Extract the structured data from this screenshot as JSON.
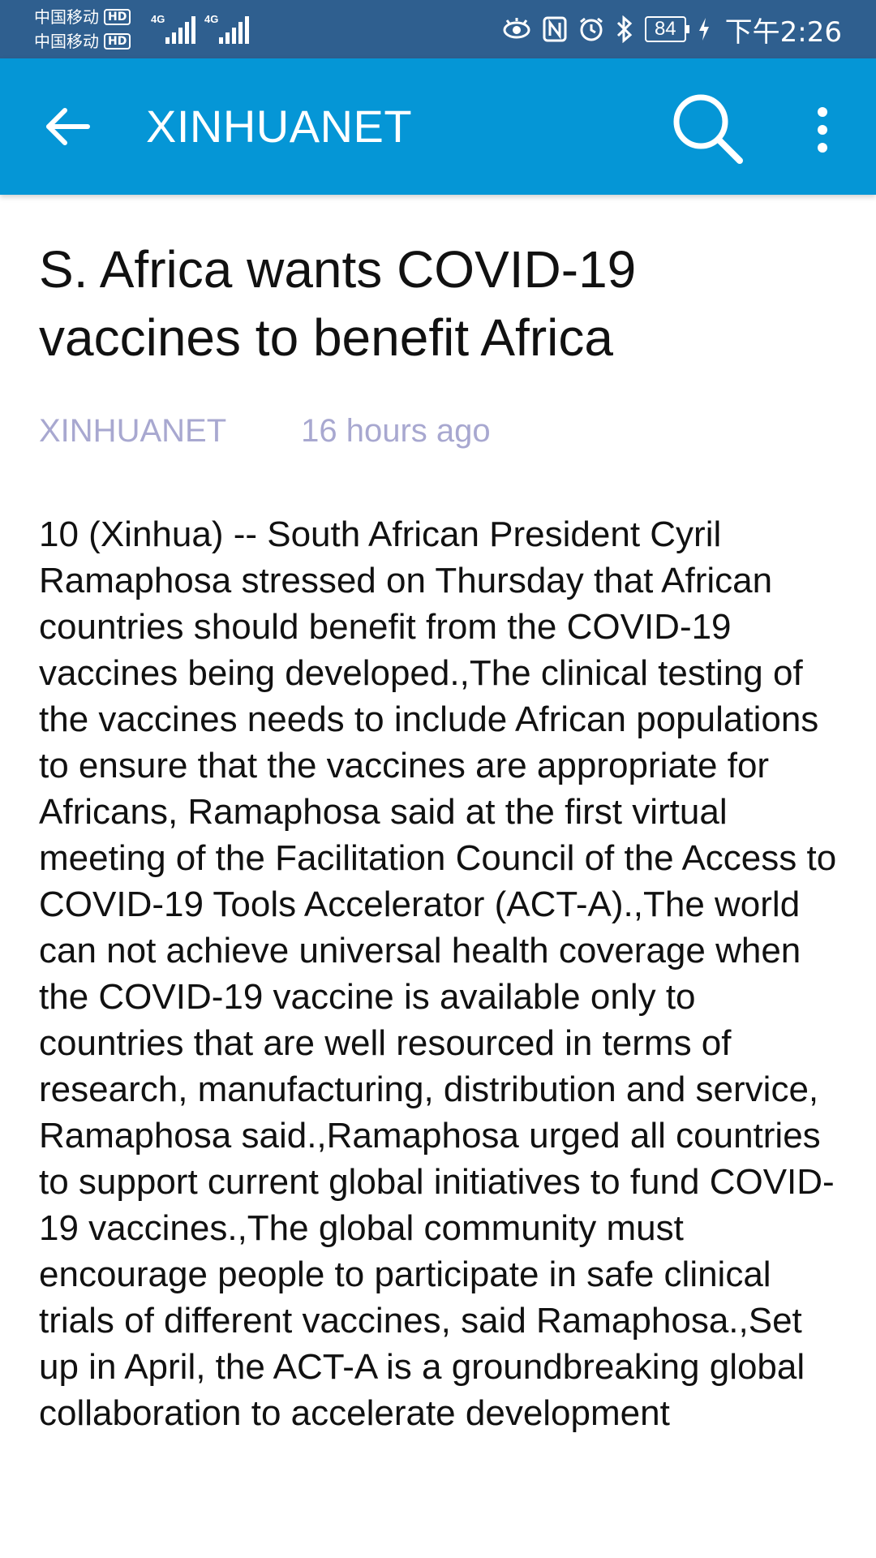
{
  "status_bar": {
    "carrier_1": "中国移动",
    "carrier_2": "中国移动",
    "hd_label": "HD",
    "network_1": "4G",
    "network_2": "4G",
    "battery_level": "84",
    "time": "下午2:26",
    "icons": [
      "eye-comfort-icon",
      "nfc-icon",
      "alarm-icon",
      "bluetooth-icon",
      "battery-icon",
      "charging-icon"
    ]
  },
  "app_bar": {
    "title": "XINHUANET",
    "color": "#0596d6",
    "icons": [
      "back-arrow-icon",
      "search-icon",
      "more-vert-icon"
    ]
  },
  "article": {
    "headline": "S. Africa wants COVID-19 vaccines to benefit Africa",
    "source": "XINHUANET",
    "time_ago": "16 hours ago",
    "body": "10 (Xinhua) -- South African President Cyril Ramaphosa stressed on Thursday that African countries should benefit from the COVID-19 vaccines being developed.,The clinical testing of the vaccines needs to include African populations to ensure that the vaccines are appropriate for Africans, Ramaphosa said at the first virtual meeting of the Facilitation Council of the Access to COVID-19 Tools Accelerator (ACT-A).,The world can not achieve universal health coverage when the COVID-19 vaccine is available only to countries that are well resourced in terms of research, manufacturing, distribution and service, Ramaphosa said.,Ramaphosa urged all countries to support current global initiatives to fund COVID-19 vaccines.,The global community must encourage people to participate in safe clinical trials of different vaccines, said Ramaphosa.,Set up in April, the ACT-A is a groundbreaking global collaboration to accelerate development"
  }
}
